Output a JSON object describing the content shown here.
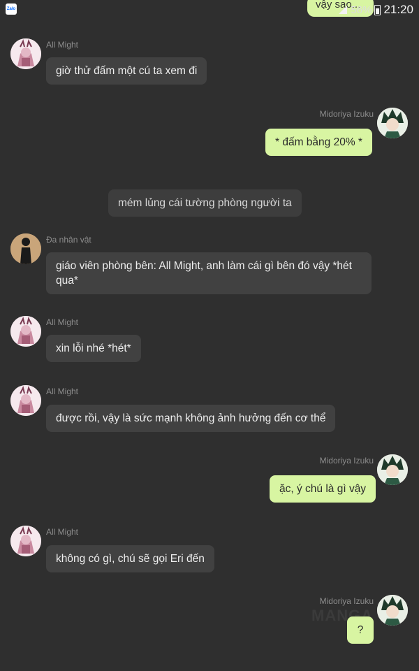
{
  "status_bar": {
    "app_icon_label": "Zalo",
    "notification_peek": "vậy sao...",
    "battery_percent": "56%",
    "time": "21:20"
  },
  "characters": {
    "all_might": "All Might",
    "midoriya": "Midoriya Izuku",
    "multi": "Đa nhân vật"
  },
  "messages": [
    {
      "sender": "All Might",
      "text": "giờ thử đấm một cú ta xem đi"
    },
    {
      "sender": "Midoriya Izuku",
      "text": "* đấm bằng 20% *"
    },
    {
      "sender": "system",
      "text": "mém lủng cái tường phòng người ta"
    },
    {
      "sender": "Đa nhân vật",
      "text": "giáo viên phòng bên: All Might, anh làm cái gì bên đó vậy *hét qua*"
    },
    {
      "sender": "All Might",
      "text": "xin lỗi nhé *hét*"
    },
    {
      "sender": "All Might",
      "text": "được rồi, vậy là sức mạnh không ảnh hưởng đến cơ thể"
    },
    {
      "sender": "Midoriya Izuku",
      "text": "ặc, ý chú là gì vậy"
    },
    {
      "sender": "All Might",
      "text": "không có gì, chú sẽ gọi Eri đến"
    },
    {
      "sender": "Midoriya Izuku",
      "text": "?"
    }
  ],
  "watermark": "MANGA",
  "colors": {
    "background": "#2f2f2f",
    "incoming_bubble": "#414141",
    "outgoing_bubble": "#d8f5a2",
    "name_text": "#8c8c8c"
  }
}
